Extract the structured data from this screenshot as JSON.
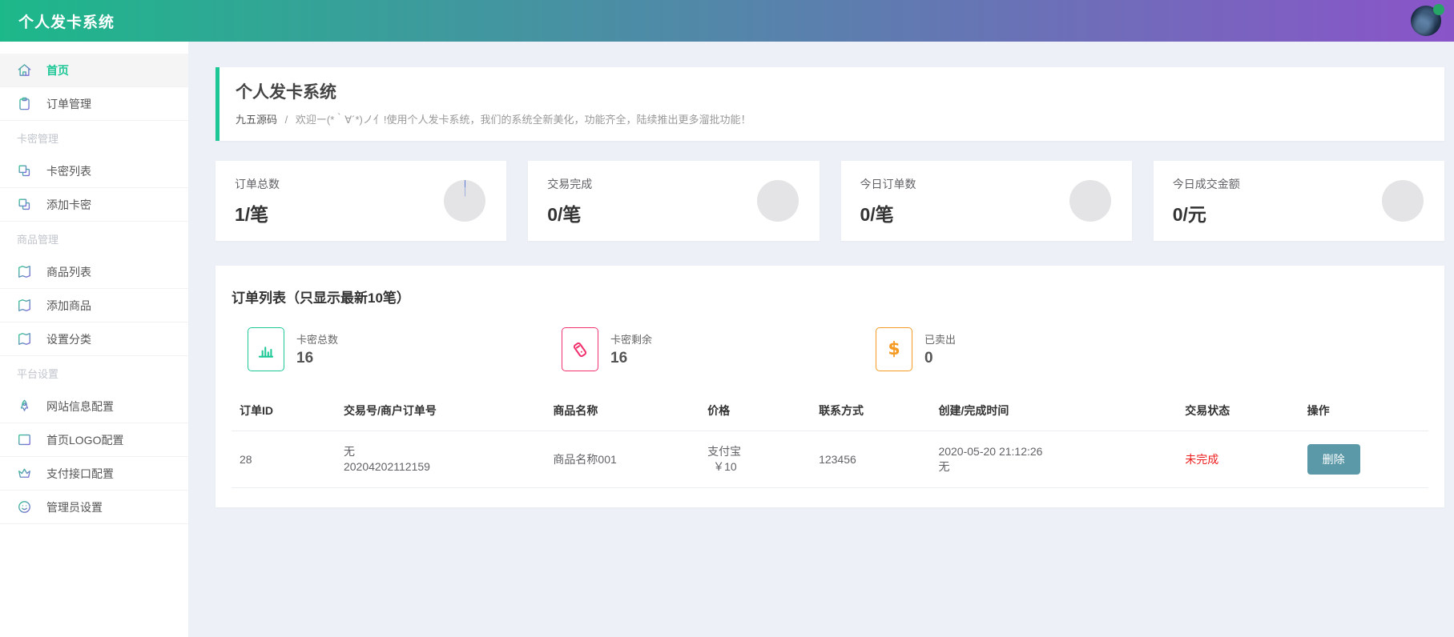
{
  "header": {
    "title": "个人发卡系统"
  },
  "sidebar": {
    "items": [
      {
        "name": "home",
        "label": "首页",
        "icon": "home-icon",
        "type": "item",
        "active": true
      },
      {
        "name": "order-management",
        "label": "订单管理",
        "icon": "clipboard-icon",
        "type": "item"
      },
      {
        "name": "card-key-management",
        "label": "卡密管理",
        "type": "section"
      },
      {
        "name": "card-key-list",
        "label": "卡密列表",
        "icon": "copy-icon",
        "type": "item"
      },
      {
        "name": "add-card-key",
        "label": "添加卡密",
        "icon": "copy-icon",
        "type": "item"
      },
      {
        "name": "product-management",
        "label": "商品管理",
        "type": "section"
      },
      {
        "name": "product-list",
        "label": "商品列表",
        "icon": "book-icon",
        "type": "item"
      },
      {
        "name": "add-product",
        "label": "添加商品",
        "icon": "book-icon",
        "type": "item"
      },
      {
        "name": "set-category",
        "label": "设置分类",
        "icon": "book-icon",
        "type": "item"
      },
      {
        "name": "platform-settings",
        "label": "平台设置",
        "type": "section"
      },
      {
        "name": "site-info-config",
        "label": "网站信息配置",
        "icon": "rocket-icon",
        "type": "item"
      },
      {
        "name": "home-logo-config",
        "label": "首页LOGO配置",
        "icon": "layout-icon",
        "type": "item"
      },
      {
        "name": "payment-api-config",
        "label": "支付接口配置",
        "icon": "crown-icon",
        "type": "item"
      },
      {
        "name": "admin-settings",
        "label": "管理员设置",
        "icon": "smiley-icon",
        "type": "item"
      }
    ]
  },
  "banner": {
    "title": "个人发卡系统",
    "brand": "九五源码",
    "separator": "/",
    "message": "欢迎ー(*｀∀´*)ノ亻!使用个人发卡系统，我们的系统全新美化，功能齐全，陆续推出更多溜批功能！"
  },
  "stat_cards": [
    {
      "name": "total-orders",
      "label": "订单总数",
      "value": "1/笔",
      "has_slice": true
    },
    {
      "name": "completed-trades",
      "label": "交易完成",
      "value": "0/笔",
      "has_slice": false
    },
    {
      "name": "today-orders",
      "label": "今日订单数",
      "value": "0/笔",
      "has_slice": false
    },
    {
      "name": "today-amount",
      "label": "今日成交金额",
      "value": "0/元",
      "has_slice": false
    }
  ],
  "orders": {
    "title": "订单列表（只显示最新10笔）",
    "mini_stats": [
      {
        "name": "card-keys-total",
        "label": "卡密总数",
        "value": "16",
        "icon": "bar-chart-icon",
        "color": "#1dc796"
      },
      {
        "name": "card-keys-remaining",
        "label": "卡密剩余",
        "value": "16",
        "icon": "pos-icon",
        "color": "#f1326e"
      },
      {
        "name": "sold-count",
        "label": "已卖出",
        "value": "0",
        "icon": "dollar-icon",
        "color": "#f59a23"
      }
    ],
    "table": {
      "columns": [
        "订单ID",
        "交易号/商户订单号",
        "商品名称",
        "价格",
        "联系方式",
        "创建/完成时间",
        "交易状态",
        "操作"
      ],
      "rows": [
        {
          "order_id": "28",
          "trade_no_line1": "无",
          "trade_no_line2": "20204202112159",
          "product_name": "商品名称001",
          "price_line1": "支付宝",
          "price_line2": "￥10",
          "contact": "123456",
          "time_line1": "2020-05-20 21:12:26",
          "time_line2": "无",
          "status": "未完成",
          "action_label": "删除"
        }
      ]
    }
  },
  "colors": {
    "header_gradient_start": "#1db88a",
    "header_gradient_end": "#8a54c9",
    "accent_green": "#1dc796",
    "status_red": "#ed1e1e",
    "delete_button": "#5b99a8",
    "mini_green": "#1dc796",
    "mini_pink": "#f1326e",
    "mini_orange": "#f59a23",
    "pie_slice_blue": "#5c7bd8",
    "online_dot": "#27a567"
  }
}
